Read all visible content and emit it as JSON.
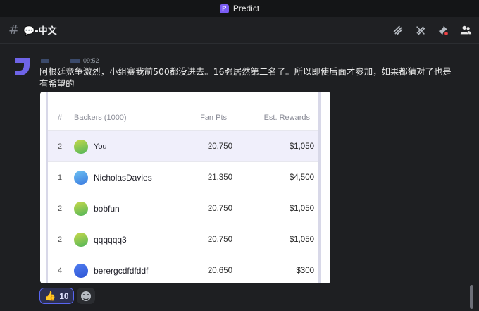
{
  "window": {
    "app_title": "Predict",
    "logo_letter": "P"
  },
  "channel": {
    "name": "💬-中文"
  },
  "message": {
    "time": "09:52",
    "text": "阿根廷竞争激烈，小组赛我前500都没进去。16强居然第二名了。所以即使后面才参加，如果都猜对了也是有希望的"
  },
  "leaderboard": {
    "headers": {
      "rank": "#",
      "backers": "Backers (1000)",
      "fan_pts": "Fan Pts",
      "rewards": "Est. Rewards"
    },
    "rows": [
      {
        "rank": "2",
        "name": "You",
        "pts": "20,750",
        "reward": "$1,050",
        "highlight": true,
        "avatar": "green"
      },
      {
        "rank": "1",
        "name": "NicholasDavies",
        "pts": "21,350",
        "reward": "$4,500",
        "highlight": false,
        "avatar": "blue"
      },
      {
        "rank": "2",
        "name": "bobfun",
        "pts": "20,750",
        "reward": "$1,050",
        "highlight": false,
        "avatar": "green"
      },
      {
        "rank": "2",
        "name": "qqqqqq3",
        "pts": "20,750",
        "reward": "$1,050",
        "highlight": false,
        "avatar": "green"
      },
      {
        "rank": "4",
        "name": "berergcdfdfddf",
        "pts": "20,650",
        "reward": "$300",
        "highlight": false,
        "avatar": "blue-dark"
      }
    ]
  },
  "reaction": {
    "emoji": "👍",
    "count": "10"
  },
  "colors": {
    "accent": "#5865f2",
    "background": "#1e1f22",
    "card": "#ffffff",
    "highlight_row": "#f0effb"
  },
  "icons": [
    "threads-icon",
    "mute-icon",
    "pin-icon",
    "members-icon",
    "thumbs-up-icon",
    "add-reaction-icon"
  ]
}
